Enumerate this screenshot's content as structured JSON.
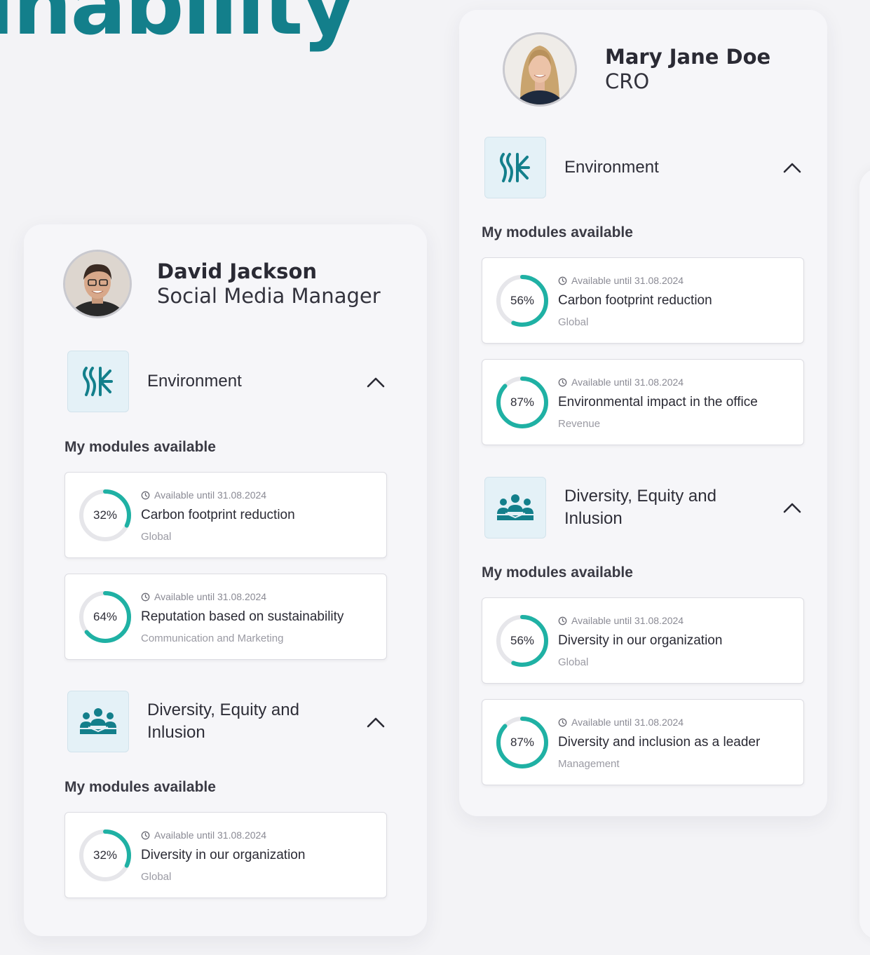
{
  "headline": "inability",
  "colors": {
    "brand_teal": "#137f8b",
    "ring_teal": "#1fb1a4",
    "ring_track": "#e6e6ea",
    "icon_bg": "#e4f1f7",
    "card_bg": "#f6f6f9"
  },
  "cards": [
    {
      "name": "David Jackson",
      "role": "Social Media Manager",
      "categories": [
        {
          "label": "Environment",
          "icon": "environment-icon",
          "section_label": "My modules available",
          "modules": [
            {
              "percent": "32%",
              "progress": 0.32,
              "available": "Available until 31.08.2024",
              "title": "Carbon footprint reduction",
              "scope": "Global"
            },
            {
              "percent": "64%",
              "progress": 0.64,
              "available": "Available until 31.08.2024",
              "title": "Reputation based on sustainability",
              "scope": "Communication and Marketing"
            }
          ]
        },
        {
          "label": "Diversity, Equity and Inlusion",
          "icon": "people-group-icon",
          "section_label": "My modules available",
          "modules": [
            {
              "percent": "32%",
              "progress": 0.32,
              "available": "Available until 31.08.2024",
              "title": "Diversity in our organization",
              "scope": "Global"
            }
          ]
        }
      ]
    },
    {
      "name": "Mary Jane Doe",
      "role": "CRO",
      "categories": [
        {
          "label": "Environment",
          "icon": "environment-icon",
          "section_label": "My modules available",
          "modules": [
            {
              "percent": "56%",
              "progress": 0.56,
              "available": "Available until 31.08.2024",
              "title": "Carbon footprint reduction",
              "scope": "Global"
            },
            {
              "percent": "87%",
              "progress": 0.87,
              "available": "Available until 31.08.2024",
              "title": "Environmental impact in the office",
              "scope": "Revenue"
            }
          ]
        },
        {
          "label": "Diversity, Equity and Inlusion",
          "icon": "people-group-icon",
          "section_label": "My modules available",
          "modules": [
            {
              "percent": "56%",
              "progress": 0.56,
              "available": "Available until 31.08.2024",
              "title": "Diversity in our organization",
              "scope": "Global"
            },
            {
              "percent": "87%",
              "progress": 0.87,
              "available": "Available until 31.08.2024",
              "title": "Diversity and inclusion as a leader",
              "scope": "Management"
            }
          ]
        }
      ]
    }
  ]
}
